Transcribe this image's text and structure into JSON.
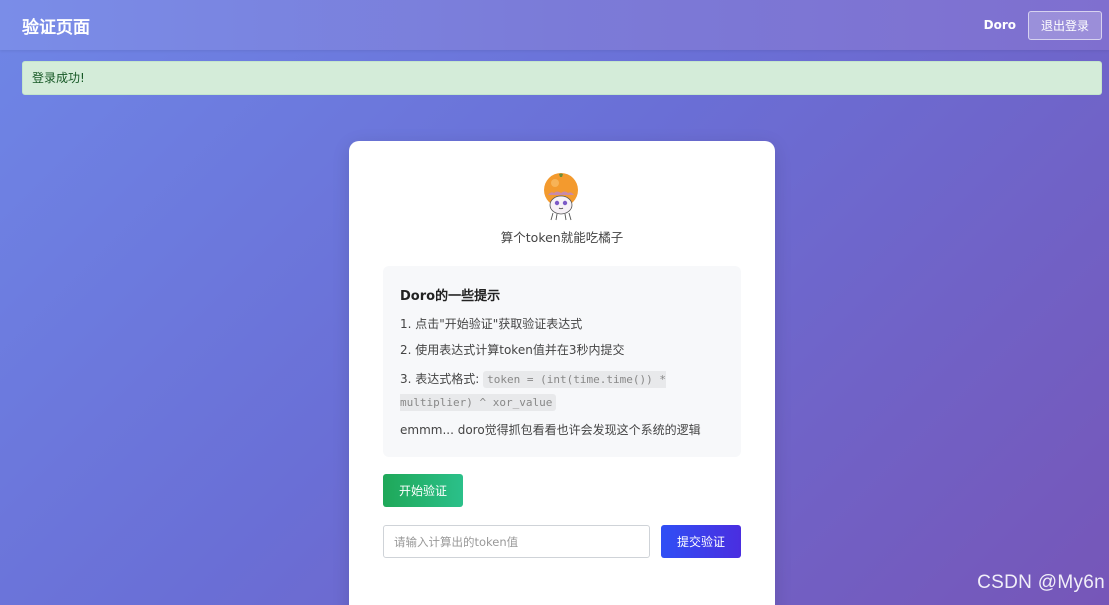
{
  "header": {
    "title": "验证页面",
    "username": "Doro",
    "logout_label": "退出登录"
  },
  "alert": {
    "message": "登录成功!"
  },
  "card": {
    "avatar_icon": "doro-orange-avatar-icon",
    "subtitle": "算个token就能吃橘子",
    "tips": {
      "title": "Doro的一些提示",
      "line1": "1. 点击\"开始验证\"获取验证表达式",
      "line2": "2. 使用表达式计算token值并在3秒内提交",
      "line3_prefix": "3. 表达式格式:",
      "line3_code": "token = (int(time.time()) * multiplier) ^ xor_value",
      "hint": "emmm... doro觉得抓包看看也许会发现这个系统的逻辑"
    },
    "start_label": "开始验证",
    "token_input": {
      "value": "",
      "placeholder": "请输入计算出的token值"
    },
    "submit_label": "提交验证"
  },
  "watermark": "CSDN @My6n",
  "colors": {
    "header_bg": "#7b7bd8",
    "alert_bg": "#d4ecd9",
    "alert_text": "#155724",
    "start_btn": "#1fa859",
    "submit_btn": "#2f4ff5"
  }
}
